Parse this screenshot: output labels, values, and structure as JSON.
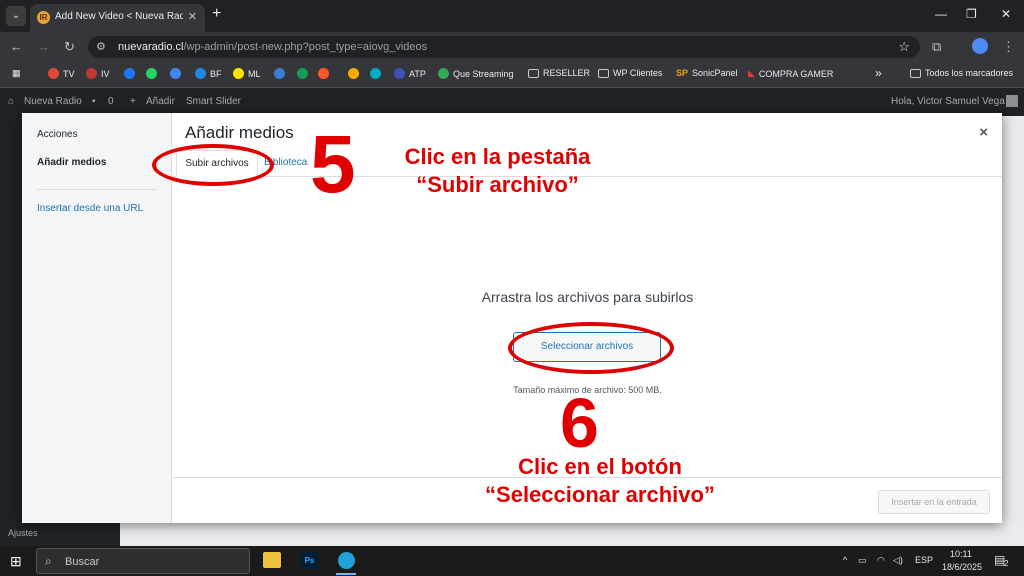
{
  "browser": {
    "tab_title": "Add New Video < Nueva Radio",
    "tab_favicon": "IR",
    "url_domain": "nuevaradio.cl",
    "url_path": "/wp-admin/post-new.php?post_type=aiovg_videos",
    "bookmarks": [
      {
        "label": "TV",
        "color": "#e04a3a"
      },
      {
        "label": "IV",
        "color": "#c0392b"
      },
      {
        "label": "",
        "color": "#1877f2"
      },
      {
        "label": "",
        "color": "#25d366"
      },
      {
        "label": "",
        "color": "#4285f4"
      },
      {
        "label": "BF",
        "color": "#1e88e5"
      },
      {
        "label": "ML",
        "color": "#ffe600"
      },
      {
        "label": "",
        "color": "#3a7bd5"
      },
      {
        "label": "",
        "color": "#0f9d58"
      },
      {
        "label": "",
        "color": "#ff5722"
      },
      {
        "label": "",
        "color": "#f9ab00"
      },
      {
        "label": "",
        "color": "#00acc1"
      },
      {
        "label": "ATP",
        "color": "#3f51b5"
      },
      {
        "label": "Que Streaming",
        "color": "#34a853"
      }
    ],
    "folders": [
      "RESELLER",
      "WP Clientes"
    ],
    "sonicpanel": "SonicPanel",
    "compra_gamer": "COMPRA GAMER",
    "all_bookmarks": "Todos los marcadores",
    "more": "»"
  },
  "wp": {
    "site_name": "Nueva Radio",
    "comments_count": "0",
    "add_new": "Añadir",
    "smart_slider": "Smart Slider",
    "greeting": "Hola, Victor Samuel Vega",
    "sidebar_settings": "Ajustes"
  },
  "modal": {
    "title": "Añadir medios",
    "menu": {
      "actions": "Acciones",
      "add_media": "Añadir medios",
      "insert_url": "Insertar desde una URL"
    },
    "tabs": {
      "upload": "Subir archivos",
      "library": "Biblioteca"
    },
    "drop_title": "Arrastra los archivos para subirlos",
    "select_button": "Seleccionar archivos",
    "max_size": "Tamaño máximo de archivo: 500 MB.",
    "insert_button": "Insertar en la entrada",
    "close": "×"
  },
  "annotations": {
    "step5_number": "5",
    "step5_line1": "Clic en la pestaña",
    "step5_line2": "“Subir archivo”",
    "step6_number": "6",
    "step6_line1": "Clic en el botón",
    "step6_line2": "“Seleccionar archivo”",
    "color": "#e00000"
  },
  "taskbar": {
    "search_placeholder": "Buscar",
    "lang": "ESP",
    "time": "10:11",
    "date": "18/6/2025",
    "notifications": "2"
  }
}
